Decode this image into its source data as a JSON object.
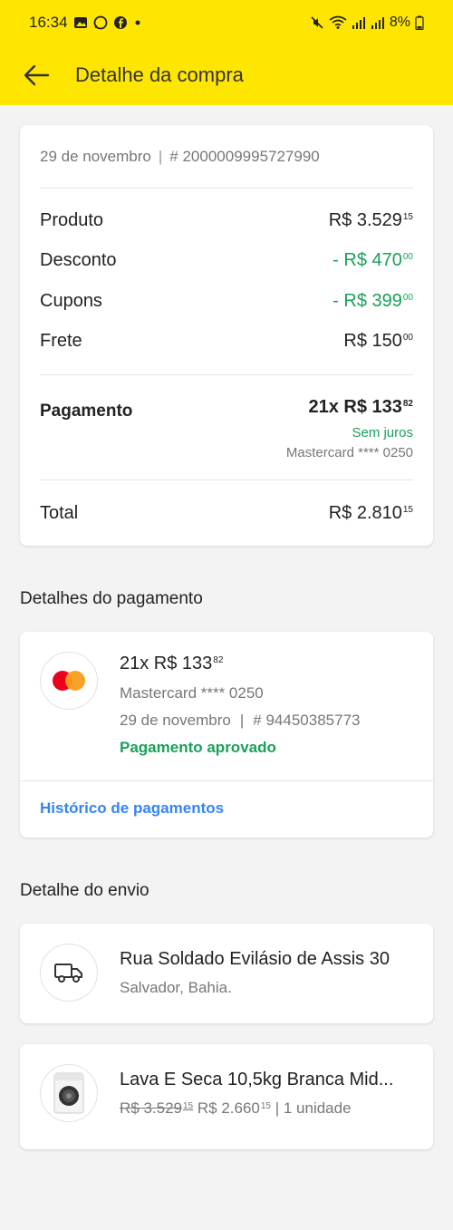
{
  "status_bar": {
    "time": "16:34",
    "battery": "8%",
    "left_icons": [
      "gallery-icon",
      "whatsapp-icon",
      "facebook-icon",
      "dot-icon"
    ],
    "right_icons": [
      "mute-icon",
      "wifi-icon",
      "signal-icon",
      "signal-icon",
      "battery-icon"
    ]
  },
  "header": {
    "title": "Detalhe da compra",
    "background": "#ffe600"
  },
  "order": {
    "date": "29 de novembro",
    "separator": "|",
    "number": "# 2000009995727990",
    "lines": [
      {
        "label": "Produto",
        "value": "R$ 3.529",
        "cents": "15"
      },
      {
        "label": "Desconto",
        "value": "- R$ 470",
        "cents": "00"
      },
      {
        "label": "Cupons",
        "value": "- R$ 399",
        "cents": "00"
      },
      {
        "label": "Frete",
        "value": "R$ 150",
        "cents": "00"
      }
    ],
    "payment": {
      "label": "Pagamento",
      "installments": "21x R$ 133",
      "cents": "82",
      "interest": "Sem juros",
      "card": "Mastercard **** 0250"
    },
    "total": {
      "label": "Total",
      "value": "R$ 2.810",
      "cents": "15"
    }
  },
  "payment_details": {
    "section_title": "Detalhes do pagamento",
    "installments": "21x R$ 133",
    "cents": "82",
    "card": "Mastercard **** 0250",
    "date": "29 de novembro",
    "separator": "|",
    "transaction": "# 94450385773",
    "status": "Pagamento aprovado",
    "history_link": "Histórico de pagamentos"
  },
  "shipping": {
    "section_title": "Detalhe do envio",
    "address": "Rua Soldado Evilásio de Assis 30",
    "city": "Salvador, Bahia.",
    "product": {
      "name": "Lava E Seca 10,5kg Branca Mid...",
      "old_price": "R$ 3.529",
      "old_cents": "15",
      "price": "R$ 2.660",
      "price_cents": "15",
      "quantity": "| 1 unidade"
    }
  },
  "colors": {
    "accent_yellow": "#ffe600",
    "green": "#1aa058",
    "link_blue": "#3483fa"
  }
}
